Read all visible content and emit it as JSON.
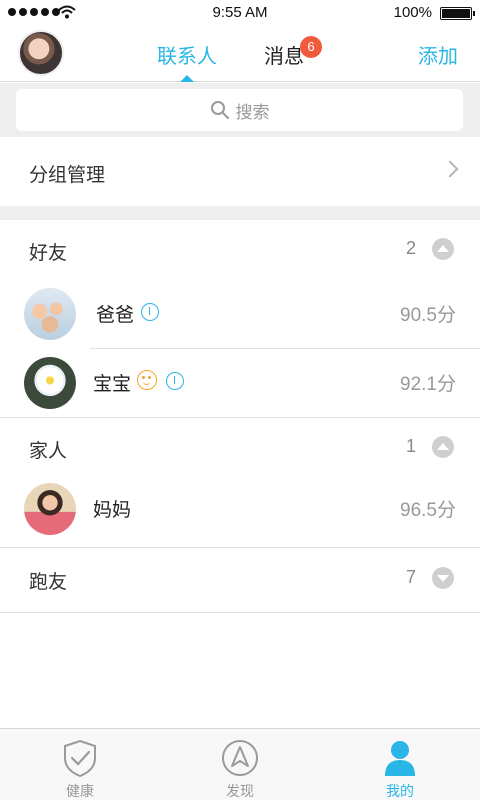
{
  "status_bar": {
    "time": "9:55 AM",
    "battery": "100%",
    "battery_level": 1.0
  },
  "header": {
    "tabs": [
      {
        "label": "联系人",
        "active": true
      },
      {
        "label": "消息",
        "active": false,
        "badge": "6"
      }
    ],
    "add_label": "添加"
  },
  "search": {
    "placeholder": "搜索"
  },
  "group_management": {
    "label": "分组管理"
  },
  "groups": [
    {
      "name": "好友",
      "count": "2",
      "expanded": true,
      "contacts": [
        {
          "name": "爸爸",
          "score": "90.5分",
          "icons": [
            "gauge-icon"
          ]
        },
        {
          "name": "宝宝",
          "score": "92.1分",
          "icons": [
            "baby-icon",
            "gauge-icon"
          ]
        }
      ]
    },
    {
      "name": "家人",
      "count": "1",
      "expanded": true,
      "contacts": [
        {
          "name": "妈妈",
          "score": "96.5分",
          "icons": []
        }
      ]
    },
    {
      "name": "跑友",
      "count": "7",
      "expanded": false,
      "contacts": []
    }
  ],
  "tab_bar": {
    "items": [
      {
        "label": "健康",
        "icon": "shield-check-icon",
        "active": false
      },
      {
        "label": "发现",
        "icon": "compass-icon",
        "active": false
      },
      {
        "label": "我的",
        "icon": "person-icon",
        "active": true
      }
    ]
  },
  "colors": {
    "accent": "#29b6e6",
    "badge": "#f25a3d",
    "baby_icon": "#f5a623",
    "inactive": "#999999",
    "background_gray": "#efefef"
  }
}
